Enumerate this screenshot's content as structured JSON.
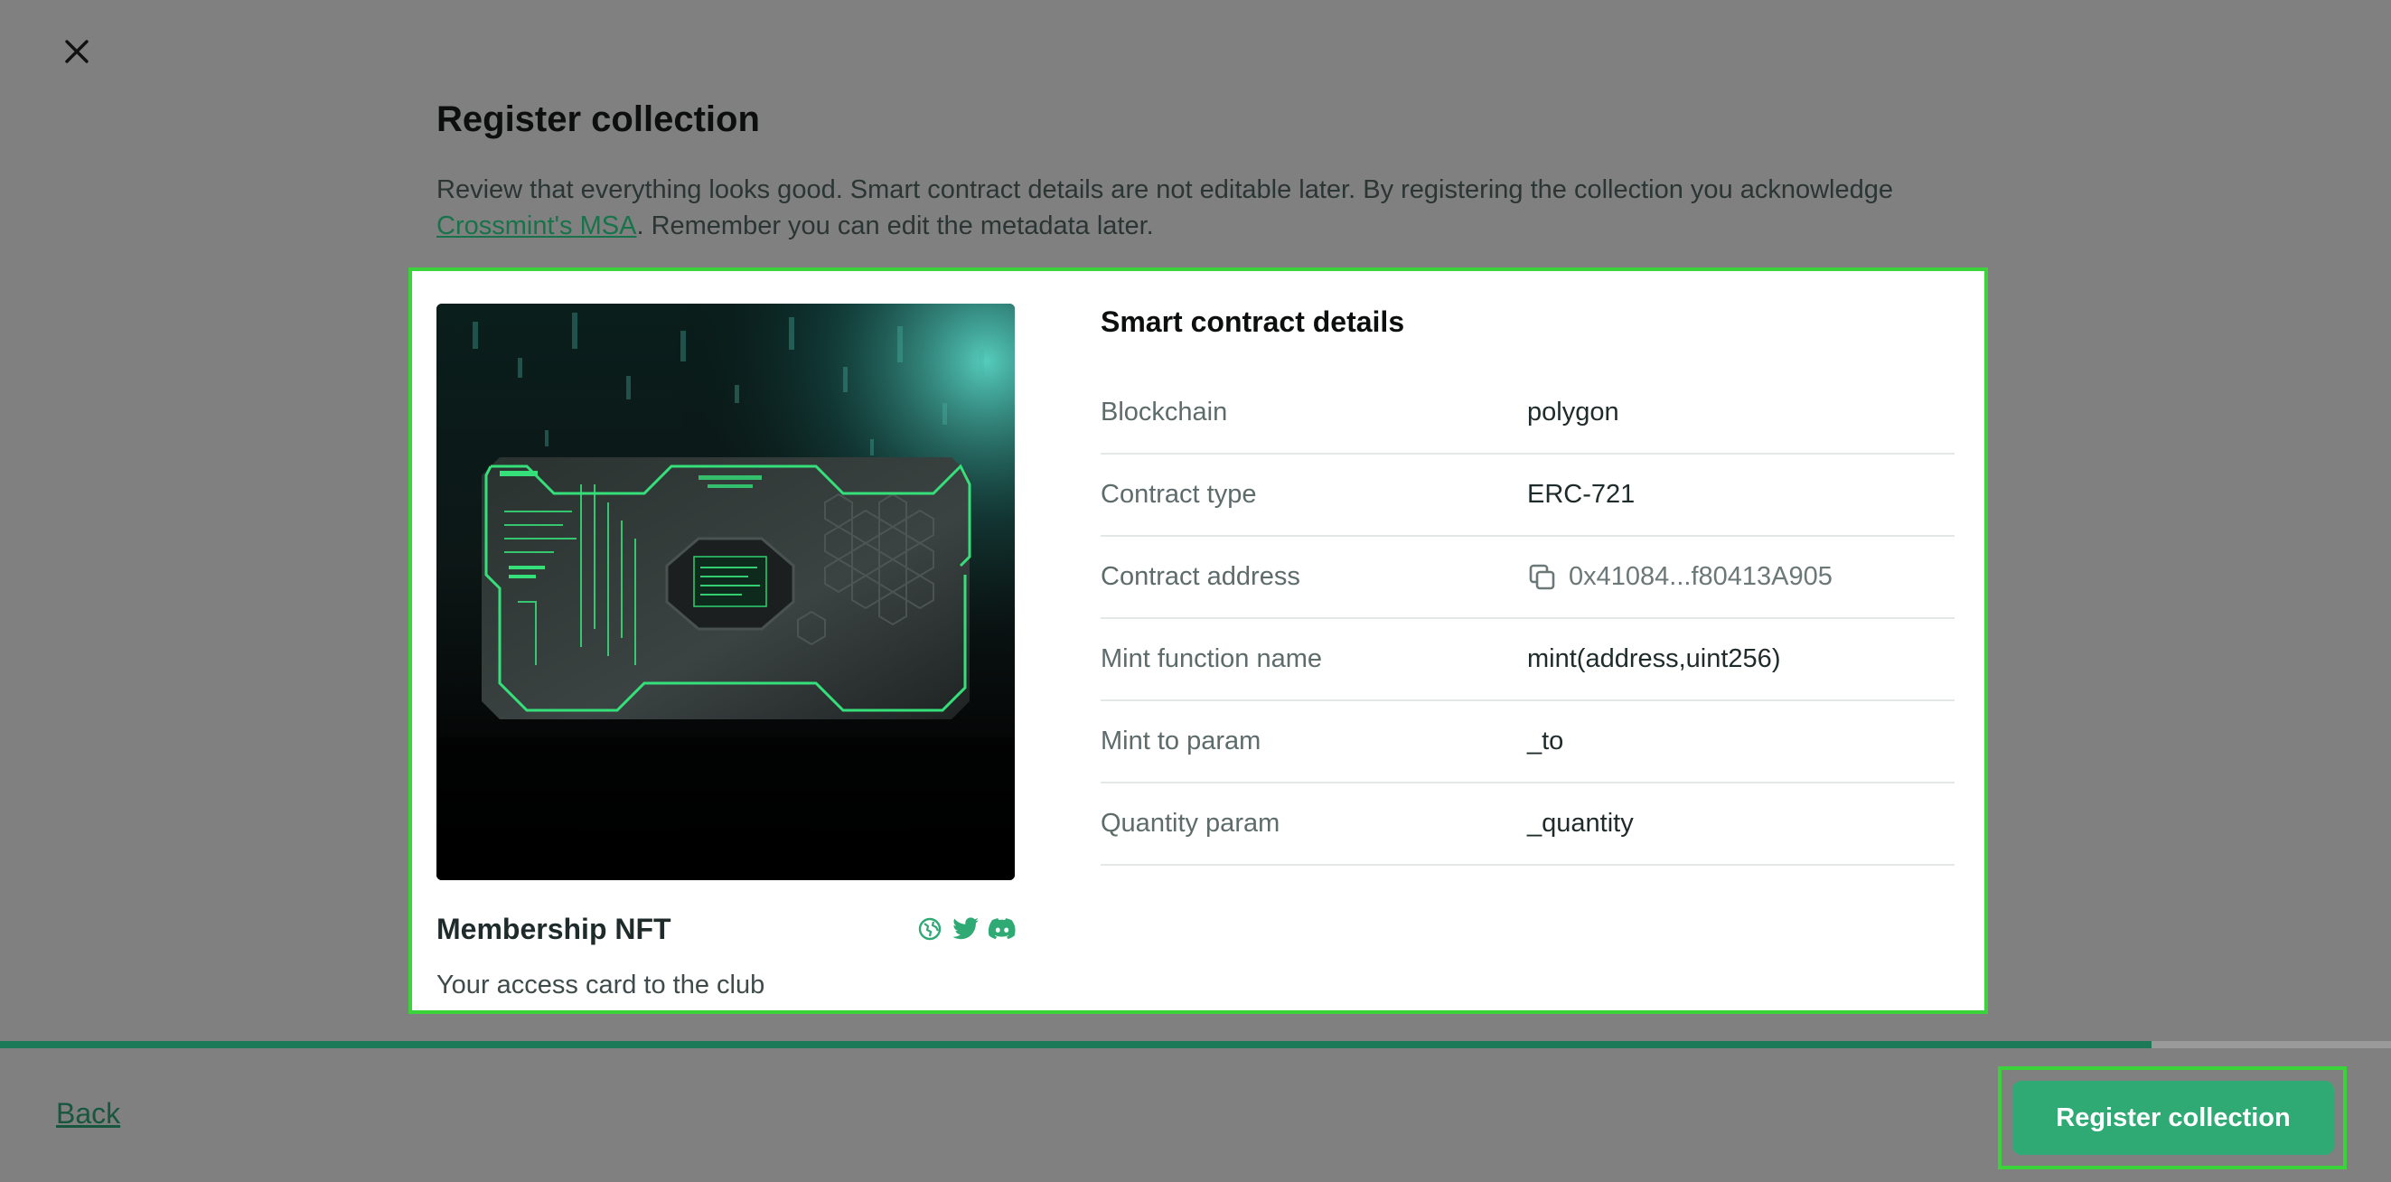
{
  "dialog": {
    "title": "Register collection",
    "intro_prefix": "Review that everything looks good. Smart contract details are not editable later. By registering the collection you acknowledge ",
    "intro_link": "Crossmint's MSA",
    "intro_suffix": ". Remember you can edit the metadata later."
  },
  "collection": {
    "name": "Membership NFT",
    "description": "Your access card to the club",
    "socials": [
      "globe-icon",
      "twitter-icon",
      "discord-icon"
    ]
  },
  "details": {
    "title": "Smart contract details",
    "rows": [
      {
        "label": "Blockchain",
        "value": "polygon"
      },
      {
        "label": "Contract type",
        "value": "ERC-721"
      },
      {
        "label": "Contract address",
        "value": "0x41084...f80413A905"
      },
      {
        "label": "Mint function name",
        "value": "mint(address,uint256)"
      },
      {
        "label": "Mint to param",
        "value": "_to"
      },
      {
        "label": "Quantity param",
        "value": "_quantity"
      }
    ]
  },
  "footer": {
    "back_label": "Back",
    "register_label": "Register collection",
    "progress_percent": 90
  },
  "colors": {
    "accent": "#2faa74",
    "link": "#17734a",
    "highlight": "#3ad43a"
  }
}
